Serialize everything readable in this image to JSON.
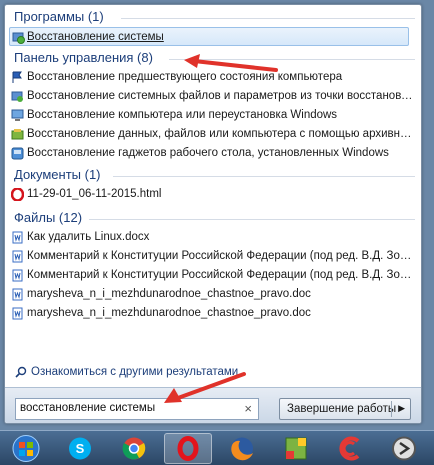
{
  "groups": [
    {
      "id": "programs",
      "title": "Программы (1)",
      "items": [
        {
          "label": "Восстановление системы",
          "icon": "system-restore-icon",
          "selected": true
        }
      ]
    },
    {
      "id": "control-panel",
      "title": "Панель управления (8)",
      "items": [
        {
          "label": "Восстановление предшествующего состояния компьютера",
          "icon": "flag-icon"
        },
        {
          "label": "Восстановление системных файлов и параметров из точки восстановления",
          "icon": "restore-point-icon"
        },
        {
          "label": "Восстановление компьютера или переустановка Windows",
          "icon": "computer-icon"
        },
        {
          "label": "Восстановление данных, файлов или компьютера с помощью архивных ко...",
          "icon": "backup-icon"
        },
        {
          "label": "Восстановление гаджетов рабочего стола, установленных Windows",
          "icon": "gadget-icon"
        }
      ]
    },
    {
      "id": "documents",
      "title": "Документы (1)",
      "items": [
        {
          "label": "11-29-01_06-11-2015.html",
          "icon": "opera-icon"
        }
      ]
    },
    {
      "id": "files",
      "title": "Файлы (12)",
      "items": [
        {
          "label": "Как удалить Linux.docx",
          "icon": "word-doc-icon"
        },
        {
          "label": "Комментарий к Конституции Российской Федерации (под ред. В.Д. Зорьки.doc",
          "icon": "word-doc-icon"
        },
        {
          "label": "Комментарий к Конституции Российской Федерации (под ред. В.Д. Зорьки.doc",
          "icon": "word-doc-icon"
        },
        {
          "label": "marysheva_n_i_mezhdunarodnoe_chastnoe_pravo.doc",
          "icon": "word-doc-icon"
        },
        {
          "label": "marysheva_n_i_mezhdunarodnoe_chastnoe_pravo.doc",
          "icon": "word-doc-icon"
        }
      ]
    }
  ],
  "see_more": "Ознакомиться с другими результатами",
  "search": {
    "value": "восстановление системы",
    "clear": "×"
  },
  "shutdown": {
    "label": "Завершение работы",
    "arrow": "▶"
  },
  "taskbar": [
    {
      "name": "start-orb-icon"
    },
    {
      "name": "skype-icon"
    },
    {
      "name": "chrome-icon"
    },
    {
      "name": "opera-icon",
      "active": true
    },
    {
      "name": "firefox-icon"
    },
    {
      "name": "game-icon"
    },
    {
      "name": "ccleaner-icon"
    },
    {
      "name": "app-icon"
    }
  ],
  "colors": {
    "accent": "#1c3e7a",
    "arrow": "#e0322a",
    "selection": "#d6e8fa"
  }
}
